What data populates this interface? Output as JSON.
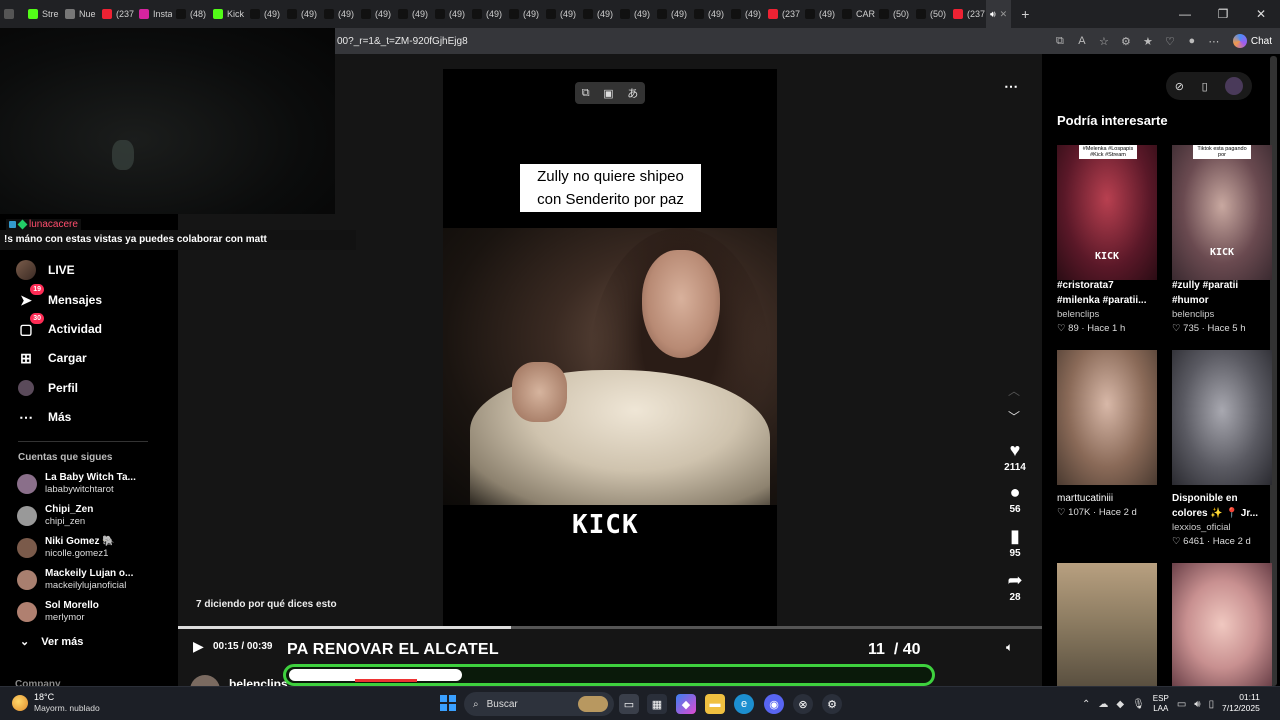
{
  "browser": {
    "tabs": [
      {
        "label": "",
        "color": "#555"
      },
      {
        "label": "Stre",
        "color": "#53fc18"
      },
      {
        "label": "Nue",
        "color": "#777"
      },
      {
        "label": "(237",
        "color": "#e23"
      },
      {
        "label": "Insta",
        "color": "#d6249f"
      },
      {
        "label": "(48)",
        "color": "#111"
      },
      {
        "label": "Kick",
        "color": "#53fc18"
      },
      {
        "label": "(49)",
        "color": "#111"
      },
      {
        "label": "(49)",
        "color": "#111"
      },
      {
        "label": "(49)",
        "color": "#111"
      },
      {
        "label": "(49)",
        "color": "#111"
      },
      {
        "label": "(49)",
        "color": "#111"
      },
      {
        "label": "(49)",
        "color": "#111"
      },
      {
        "label": "(49)",
        "color": "#111"
      },
      {
        "label": "(49)",
        "color": "#111"
      },
      {
        "label": "(49)",
        "color": "#111"
      },
      {
        "label": "(49)",
        "color": "#111"
      },
      {
        "label": "(49)",
        "color": "#111"
      },
      {
        "label": "(49)",
        "color": "#111"
      },
      {
        "label": "(49)",
        "color": "#111"
      },
      {
        "label": "(49)",
        "color": "#111"
      },
      {
        "label": "(237",
        "color": "#e23"
      },
      {
        "label": "(49)",
        "color": "#111"
      },
      {
        "label": "CAR",
        "color": "#111"
      },
      {
        "label": "(50)",
        "color": "#111"
      },
      {
        "label": "(50)",
        "color": "#111"
      },
      {
        "label": "(237",
        "color": "#e23"
      }
    ],
    "new_tab_label": "+",
    "url": "00?_r=1&_t=ZM-920fGjhEjg8",
    "chat_label": "Chat"
  },
  "chat_overlay": {
    "username": "lunacacere",
    "message": "!s máno con estas vistas ya puedes colaborar con matt"
  },
  "sidebar": {
    "nav": [
      {
        "label": "LIVE",
        "icon": "live-icon",
        "badge": ""
      },
      {
        "label": "Mensajes",
        "icon": "message-icon",
        "badge": "19"
      },
      {
        "label": "Actividad",
        "icon": "activity-icon",
        "badge": "30"
      },
      {
        "label": "Cargar",
        "icon": "upload-icon",
        "badge": ""
      },
      {
        "label": "Perfil",
        "icon": "profile-icon",
        "badge": ""
      },
      {
        "label": "Más",
        "icon": "more-icon",
        "badge": ""
      }
    ],
    "following_title": "Cuentas que sigues",
    "following": [
      {
        "name": "La Baby Witch Ta...",
        "handle": "lababywitchtarot",
        "color": "#8a6f8a"
      },
      {
        "name": "Chipi_Zen",
        "handle": "chipi_zen",
        "color": "#999"
      },
      {
        "name": "Niki Gomez 🐘",
        "handle": "nicolle.gomez1",
        "color": "#7a5a4a"
      },
      {
        "name": "Mackeily Lujan o...",
        "handle": "mackeilylujanoficial",
        "color": "#a87f6f"
      },
      {
        "name": "Sol Morello",
        "handle": "merlymor",
        "color": "#b08070"
      }
    ],
    "see_more": "Ver más",
    "company": "Company"
  },
  "video": {
    "caption_line1": "Zully no quiere shipeo",
    "caption_line2": "con Senderito por paz",
    "watermark": "KICK",
    "subtitle": "7 diciendo por qué dices esto",
    "timecode": "00:15 / 00:39",
    "progress": 0.385,
    "creator": "belenclips",
    "tool_icons": [
      "pip-icon",
      "miniplayer-icon",
      "translate-icon"
    ]
  },
  "actions": {
    "likes": "2114",
    "comments": "56",
    "saves": "95",
    "shares": "28"
  },
  "game_overlay": {
    "title": "PA RENOVAR EL ALCATEL",
    "count": "11",
    "total": "/ 40",
    "progress": 0.27,
    "border_color": "#3ed13e"
  },
  "recommendations": {
    "title": "Podría interesarte",
    "items": [
      {
        "title1": "#cristorata7",
        "title2": "#milenka #paratii...",
        "user": "belenclips",
        "likes": "89",
        "age": "Hace 1 h",
        "top_text": "#Melenka #Lospapis #Kick #Stream",
        "kick": "KICK",
        "bg": "#7a2030"
      },
      {
        "title1": "#zully #paratii",
        "title2": "#humor",
        "user": "belenclips",
        "likes": "735",
        "age": "Hace 5 h",
        "top_text": "Tiktok esta pagando por",
        "kick": "KICK",
        "bg": "#5a4048"
      },
      {
        "title1": "marttucatiniii",
        "title2": "",
        "user": "",
        "likes": "107K",
        "age": "Hace 2 d",
        "top_text": "",
        "kick": "",
        "bg": "#8a7060"
      },
      {
        "title1": "Disponible en",
        "title2": "colores ✨ 📍 Jr...",
        "user": "lexxios_oficial",
        "likes": "6461",
        "age": "Hace 2 d",
        "top_text": "",
        "kick": "",
        "bg": "#6a6a70"
      },
      {
        "title1": "",
        "title2": "",
        "user": "",
        "likes": "",
        "age": "",
        "top_text": "",
        "kick": "",
        "bg": "#9a8a70"
      },
      {
        "title1": "",
        "title2": "",
        "user": "",
        "likes": "",
        "age": "",
        "top_text": "",
        "kick": "",
        "bg": "#c8a090"
      }
    ]
  },
  "taskbar": {
    "temp": "18°C",
    "weather": "Mayorm. nublado",
    "search": "Buscar",
    "lang1": "ESP",
    "lang2": "LAA",
    "time": "01:11",
    "date": "7/12/2025"
  }
}
